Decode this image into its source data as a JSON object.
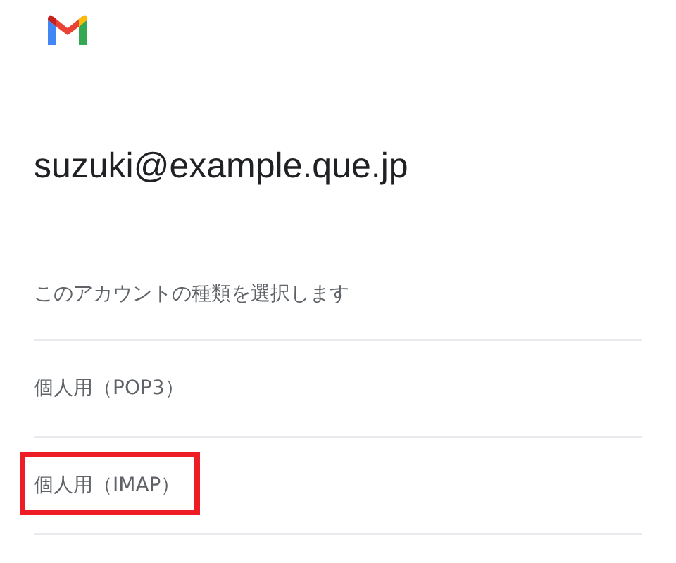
{
  "account": {
    "email": "suzuki@example.que.jp"
  },
  "prompt": "このアカウントの種類を選択します",
  "options": [
    {
      "label": "個人用（POP3）",
      "highlighted": false
    },
    {
      "label": "個人用（IMAP）",
      "highlighted": true
    }
  ]
}
